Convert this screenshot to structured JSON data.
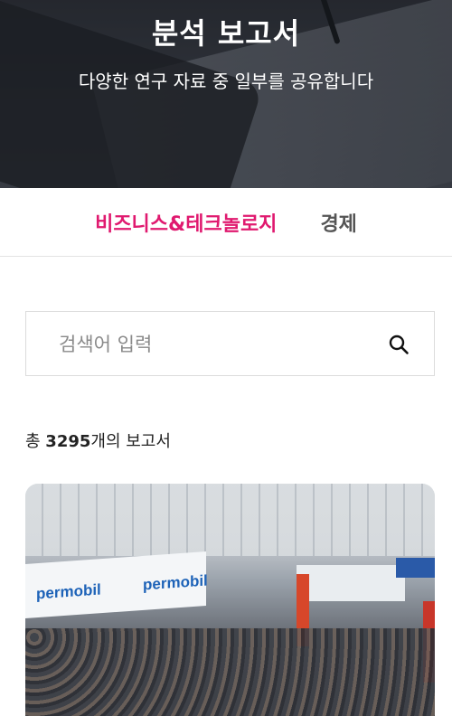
{
  "hero": {
    "title": "분석 보고서",
    "subtitle": "다양한 연구 자료 중 일부를 공유합니다"
  },
  "tabs": [
    {
      "label": "비즈니스&테크놀로지",
      "active": true
    },
    {
      "label": "경제",
      "active": false
    }
  ],
  "search": {
    "placeholder": "검색어 입력",
    "value": "",
    "icon": "search-icon"
  },
  "summary": {
    "prefix": "총 ",
    "count": "3295",
    "suffix": "개의 보고서"
  },
  "card": {
    "logos": [
      "permobil",
      "permobil"
    ]
  },
  "colors": {
    "accent": "#e0196f",
    "tab_inactive": "#555555",
    "border": "#dcdcdc"
  }
}
